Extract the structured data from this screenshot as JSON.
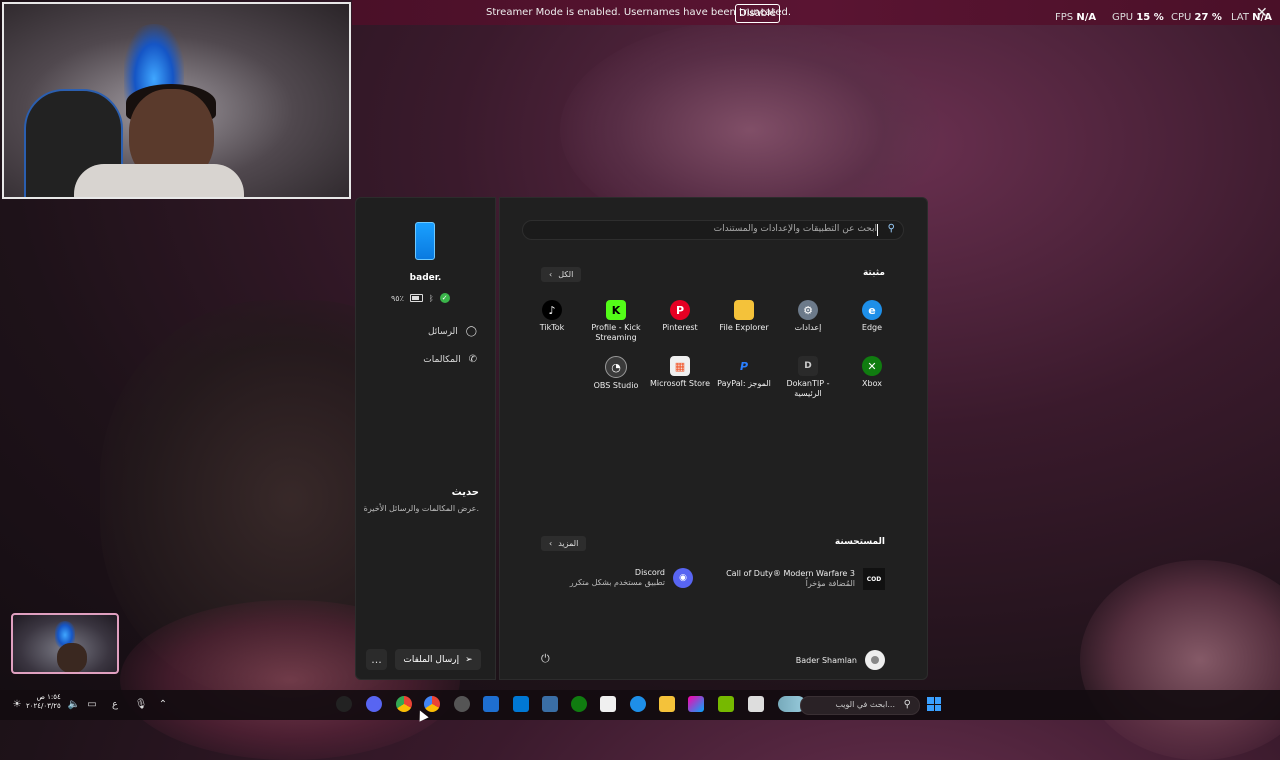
{
  "overlay": {
    "streamer_msg": "Streamer Mode is enabled. Usernames have been truncated.",
    "disable_label": "Disable",
    "fps_label": "FPS",
    "fps_value": "N/A",
    "gpu_label": "GPU",
    "gpu_value": "15 %",
    "cpu_label": "CPU",
    "cpu_value": "27 %",
    "lat_label": "LAT",
    "lat_value": "N/A"
  },
  "phone": {
    "name": "bader.",
    "battery": "٩٥٪",
    "messages": "الرسائل",
    "calls": "المكالمات",
    "recent_title": "حديث",
    "recent_sub": "عرض المكالمات والرسائل الأخيرة.",
    "send_files": "إرسال الملفات",
    "more": "..."
  },
  "start": {
    "search_placeholder": "ابحث عن التطبيقات والإعدادات والمستندات",
    "pinned_title": "مثبتة",
    "all_label": "الكل",
    "pinned": [
      {
        "label": "Edge",
        "icon": "edge-icon",
        "color": "#1e8fe8"
      },
      {
        "label": "إعدادات",
        "icon": "settings-icon",
        "color": "#6c7a8a"
      },
      {
        "label": "File Explorer",
        "icon": "folder-icon",
        "color": "#f4c23a"
      },
      {
        "label": "Pinterest",
        "icon": "pinterest-icon",
        "color": "#e60023"
      },
      {
        "label": "Profile - Kick Streaming",
        "icon": "kick-icon",
        "color": "#53fc18"
      },
      {
        "label": "TikTok",
        "icon": "tiktok-icon",
        "color": "#000000"
      },
      {
        "label": "Xbox",
        "icon": "xbox-icon",
        "color": "#107c10"
      },
      {
        "label": "DokanTIP - الرئيسية",
        "icon": "dokantip-icon",
        "color": "#2a2a2a"
      },
      {
        "label": "PayPal: الموجز",
        "icon": "paypal-icon",
        "color": "#0a2a6a"
      },
      {
        "label": "Microsoft Store",
        "icon": "store-icon",
        "color": "#f0f0f0"
      },
      {
        "label": "OBS Studio",
        "icon": "obs-icon",
        "color": "#3a3a3a"
      }
    ],
    "recommended_title": "المستحسنة",
    "more_label": "المزيد",
    "recommended": [
      {
        "title": "Call of Duty® Modern Warfare 3",
        "sub": "المُضافة مؤخراً",
        "icon": "cod-icon"
      },
      {
        "title": "Discord",
        "sub": "تطبيق مستخدم بشكل متكرر",
        "icon": "discord-icon"
      }
    ],
    "user_name": "Bader Shamlan"
  },
  "taskbar": {
    "time": "١:٥٤ ص",
    "date": "٢٠٢٤/٠٣/٢٥",
    "lang": "ع",
    "search_placeholder": "ابحث في الويب..."
  }
}
